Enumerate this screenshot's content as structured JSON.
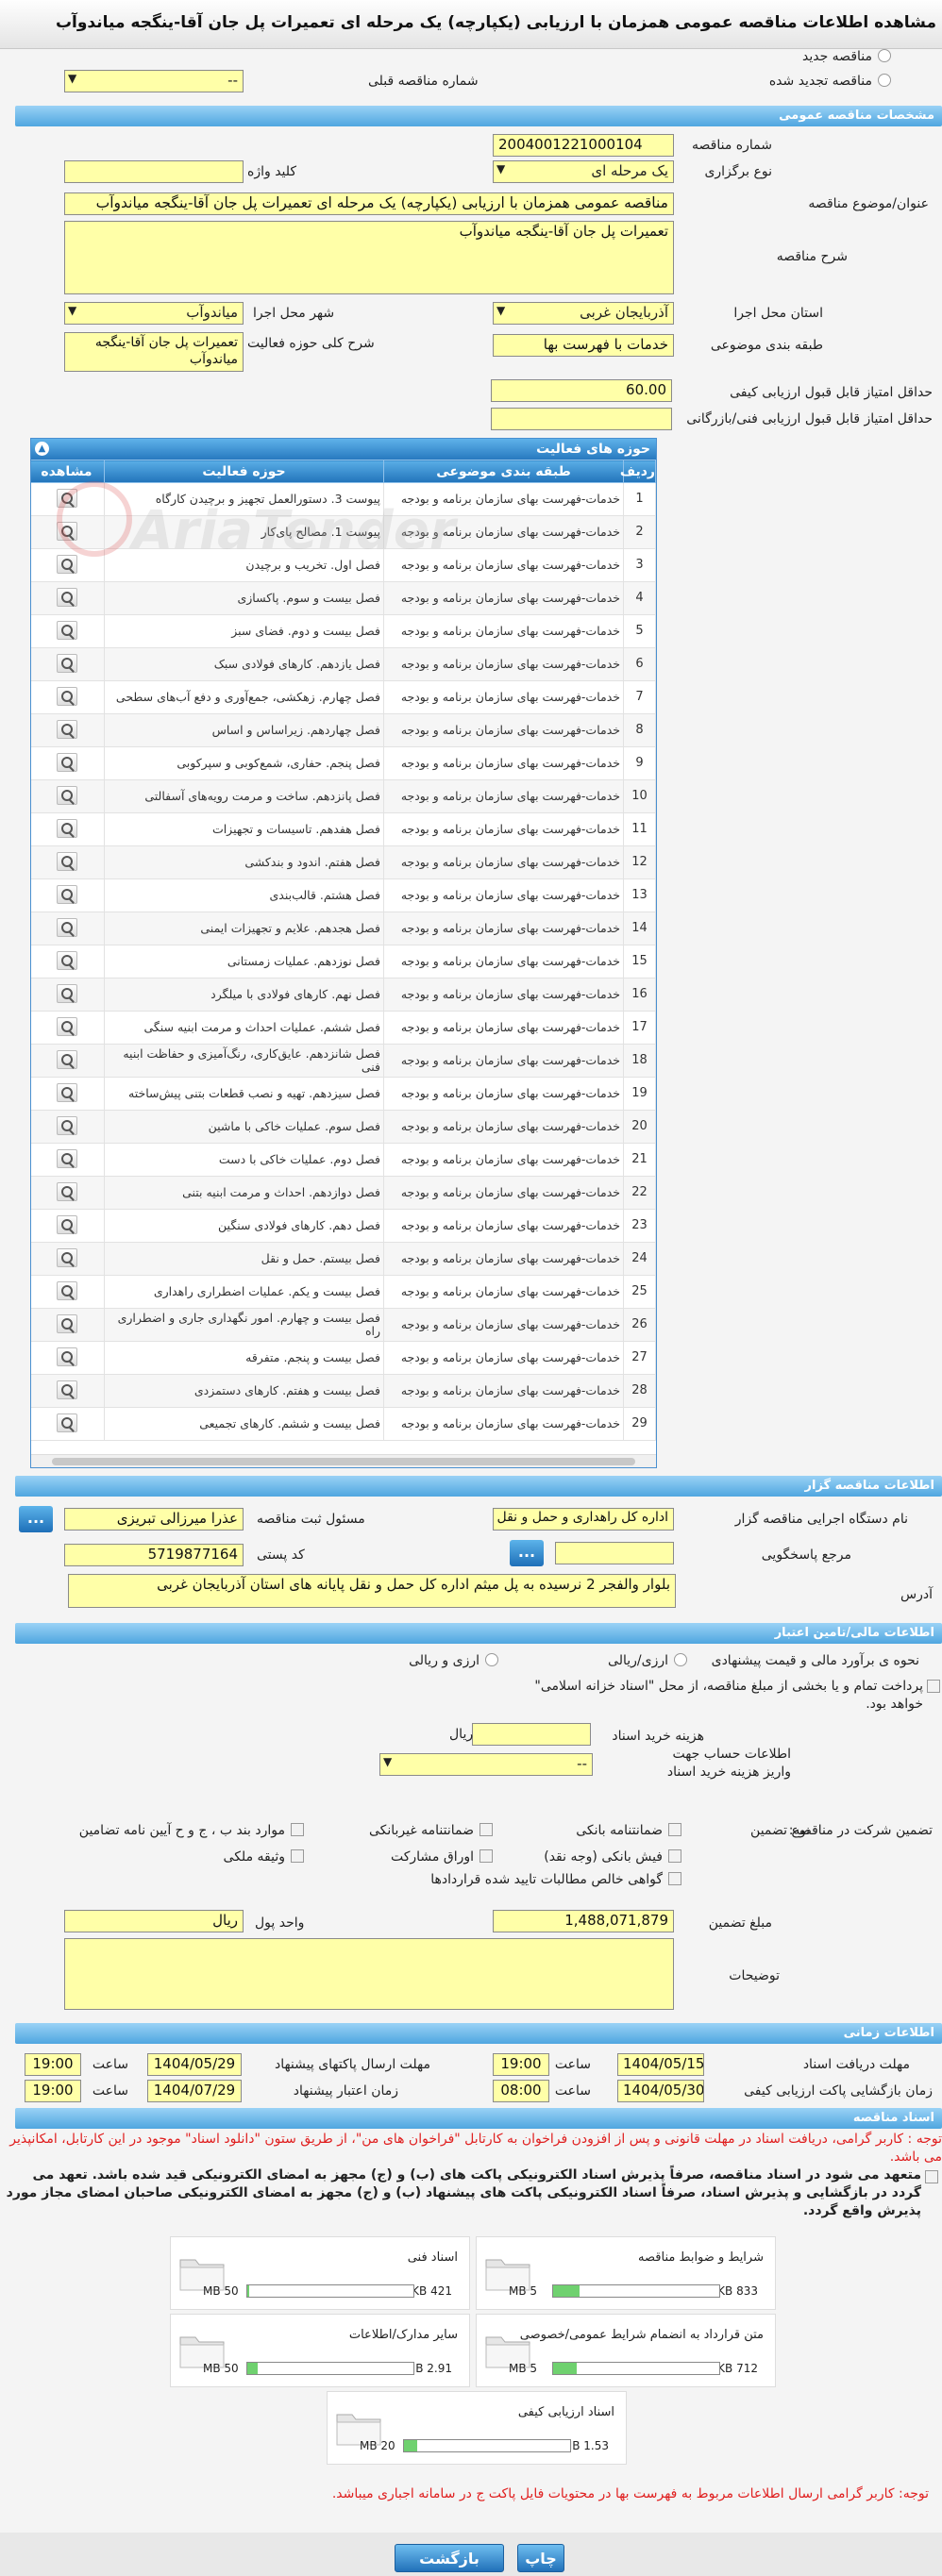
{
  "page": {
    "title": "مشاهده اطلاعات مناقصه عمومی همزمان با ارزیابی (یکپارچه) یک مرحله ای تعمیرات پل جان آقا-ینگجه میاندوآب"
  },
  "top": {
    "new_tender": "مناقصه جدید",
    "renewed_tender": "مناقصه تجدید شده",
    "prev_number_label": "شماره مناقصه قبلی",
    "prev_number_value": "--"
  },
  "general": {
    "bar": "مشخصات مناقصه عمومی",
    "number_label": "شماره مناقصه",
    "number_value": "2004001221000104",
    "type_label": "نوع برگزاری",
    "type_value": "یک مرحله ای",
    "keyword_label": "کلید واژه",
    "keyword_value": "",
    "title_label": "عنوان/موضوع مناقصه",
    "title_value": "مناقصه عمومی همزمان با ارزیابی (یکپارچه) یک مرحله ای تعمیرات پل جان آقا-ینگجه میاندوآب",
    "desc_label": "شرح مناقصه",
    "desc_value": "تعمیرات پل جان آقا-ینگجه میاندوآب",
    "province_label": "استان محل اجرا",
    "province_value": "آذربایجان غربی",
    "city_label": "شهر محل اجرا",
    "city_value": "میاندوآب",
    "category_label": "طبقه بندی موضوعی",
    "category_value": "خدمات با فهرست بها",
    "scope_label": "شرح کلی حوزه فعالیت",
    "scope_value": "تعمیرات پل جان آقا-ینگجه میاندوآب",
    "min_quality_label": "حداقل امتیاز قابل قبول ارزیابی کیفی",
    "min_quality_value": "60.00",
    "min_tech_label": "حداقل امتیاز قابل قبول ارزیابی فنی/بازرگانی",
    "min_tech_value": ""
  },
  "grid": {
    "title": "حوزه های فعالیت",
    "headers": [
      "ردیف",
      "طبقه بندی موضوعی",
      "حوزه فعالیت",
      "مشاهده"
    ],
    "rows": [
      [
        "1",
        "خدمات-فهرست بهای سازمان برنامه و بودجه",
        "پیوست 3. دستورالعمل تجهیز و برچیدن کارگاه"
      ],
      [
        "2",
        "خدمات-فهرست بهای سازمان برنامه و بودجه",
        "پیوست 1. مصالح پای‌کار"
      ],
      [
        "3",
        "خدمات-فهرست بهای سازمان برنامه و بودجه",
        "فصل اول. تخریب و برچیدن"
      ],
      [
        "4",
        "خدمات-فهرست بهای سازمان برنامه و بودجه",
        "فصل بیست و سوم. پاکسازی"
      ],
      [
        "5",
        "خدمات-فهرست بهای سازمان برنامه و بودجه",
        "فصل بیست و دوم. فضای سبز"
      ],
      [
        "6",
        "خدمات-فهرست بهای سازمان برنامه و بودجه",
        "فصل یازدهم. کارهای فولادی سبک"
      ],
      [
        "7",
        "خدمات-فهرست بهای سازمان برنامه و بودجه",
        "فصل چهارم. زهکشی، جمع‌آوری و دفع آب‌های سطحی"
      ],
      [
        "8",
        "خدمات-فهرست بهای سازمان برنامه و بودجه",
        "فصل چهاردهم. زیراساس و اساس"
      ],
      [
        "9",
        "خدمات-فهرست بهای سازمان برنامه و بودجه",
        "فصل پنجم. حفاری، شمع‌کوبی و سپرکوبی"
      ],
      [
        "10",
        "خدمات-فهرست بهای سازمان برنامه و بودجه",
        "فصل پانزدهم. ساخت و مرمت رویه‌های آسفالتی"
      ],
      [
        "11",
        "خدمات-فهرست بهای سازمان برنامه و بودجه",
        "فصل هفدهم. تاسیسات و تجهیزات"
      ],
      [
        "12",
        "خدمات-فهرست بهای سازمان برنامه و بودجه",
        "فصل هفتم. اندود و بندکشی"
      ],
      [
        "13",
        "خدمات-فهرست بهای سازمان برنامه و بودجه",
        "فصل هشتم. قالب‌بندی"
      ],
      [
        "14",
        "خدمات-فهرست بهای سازمان برنامه و بودجه",
        "فصل هجدهم. علایم و تجهیزات ایمنی"
      ],
      [
        "15",
        "خدمات-فهرست بهای سازمان برنامه و بودجه",
        "فصل نوزدهم. عملیات زمستانی"
      ],
      [
        "16",
        "خدمات-فهرست بهای سازمان برنامه و بودجه",
        "فصل نهم. کارهای فولادی با میلگرد"
      ],
      [
        "17",
        "خدمات-فهرست بهای سازمان برنامه و بودجه",
        "فصل ششم.  عملیات احداث و مرمت ابنیه سنگی"
      ],
      [
        "18",
        "خدمات-فهرست بهای سازمان برنامه و بودجه",
        "فصل شانزدهم. عایق‌کاری، رنگ‌آمیزی و حفاظت ابنیه فنی"
      ],
      [
        "19",
        "خدمات-فهرست بهای سازمان برنامه و بودجه",
        "فصل سیزدهم. تهیه و نصب قطعات بتنی پیش‌ساخته"
      ],
      [
        "20",
        "خدمات-فهرست بهای سازمان برنامه و بودجه",
        "فصل سوم. عملیات خاکی با ماشین"
      ],
      [
        "21",
        "خدمات-فهرست بهای سازمان برنامه و بودجه",
        "فصل دوم. عملیات خاکی با دست"
      ],
      [
        "22",
        "خدمات-فهرست بهای سازمان برنامه و بودجه",
        "فصل دوازدهم. احداث و مرمت ابنیه بتنی"
      ],
      [
        "23",
        "خدمات-فهرست بهای سازمان برنامه و بودجه",
        "فصل دهم. کارهای فولادی سنگین"
      ],
      [
        "24",
        "خدمات-فهرست بهای سازمان برنامه و بودجه",
        "فصل بیستم. حمل و نقل"
      ],
      [
        "25",
        "خدمات-فهرست بهای سازمان برنامه و بودجه",
        "فصل بیست و یکم. عملیات اضطراری راهداری"
      ],
      [
        "26",
        "خدمات-فهرست بهای سازمان برنامه و بودجه",
        "فصل بیست و چهارم. امور نگهداری جاری و اضطراری راه"
      ],
      [
        "27",
        "خدمات-فهرست بهای سازمان برنامه و بودجه",
        "فصل بیست و پنجم. متفرقه"
      ],
      [
        "28",
        "خدمات-فهرست بهای سازمان برنامه و بودجه",
        "فصل بیست و هفتم. کارهای دستمزدی"
      ],
      [
        "29",
        "خدمات-فهرست بهای سازمان برنامه و بودجه",
        "فصل بیست و ششم. کارهای تجمیعی"
      ]
    ]
  },
  "organizer": {
    "bar": "اطلاعات مناقصه گزار",
    "name_label": "نام دستگاه اجرایی مناقصه گزار",
    "name_value": "اداره کل راهداری و حمل و نقل",
    "owner_label": "مسئول ثبت مناقصه",
    "owner_value": "عذرا میرزالی تبریزی",
    "ref_label": "مرجع پاسخگویی",
    "ref_value": "",
    "postal_label": "کد پستی",
    "postal_value": "5719877164",
    "address_label": "آدرس",
    "address_value": "بلوار والفجر 2 نرسیده به پل میثم اداره کل حمل و نقل پایانه های استان آذربایجان غربی",
    "dots": "..."
  },
  "finance": {
    "bar": "اطلاعات مالی/تامین اعتبار",
    "estimate_label": "نحوه ی برآورد مالی و قیمت پیشنهادی",
    "opt1": "ارزی/ریالی",
    "opt2": "ارزی و ریالی",
    "treasury_text": "پرداخت تمام و یا بخشی از مبلغ مناقصه، از محل \"اسناد خزانه اسلامی\" خواهد بود.",
    "doc_fee_label": "هزینه خرید اسناد",
    "doc_fee_unit": "ریال",
    "account_label": "اطلاعات حساب جهت واریز هزینه خرید اسناد",
    "account_value": "--"
  },
  "guarantee": {
    "participation_label": "تضمین شرکت در مناقصه:",
    "type_label": "نوع تضمین",
    "items": [
      "ضمانتنامه بانکی",
      "ضمانتنامه غیربانکی",
      "موارد بند ب ، ج و ح آیین نامه تضامین",
      "فیش بانکی (وجه نقد)",
      "اوراق مشارکت",
      "وثیقه ملکی",
      "گواهی خالص مطالبات تایید شده قراردادها"
    ],
    "amount_label": "مبلغ تضمین",
    "amount_value": "1,488,071,879",
    "unit_label": "واحد پول",
    "unit_value": "ریال",
    "notes_label": "توضیحات",
    "notes_value": ""
  },
  "time": {
    "bar": "اطلاعات زمانی",
    "recv_label": "مهلت دریافت اسناد",
    "recv_date": "1404/05/15",
    "recv_time": "19:00",
    "send_label": "مهلت ارسال پاکتهای پیشنهاد",
    "send_date": "1404/05/29",
    "send_time": "19:00",
    "open_label": "زمان بازگشایی پاکت ارزیابی کیفی",
    "open_date": "1404/05/30",
    "open_time": "08:00",
    "valid_label": "زمان اعتبار پیشنهاد",
    "valid_date": "1404/07/29",
    "valid_time": "19:00",
    "time_word": "ساعت"
  },
  "docs": {
    "bar": "اسناد مناقصه",
    "notice1": "توجه : کاربر گرامی، دریافت اسناد در مهلت قانونی و پس از افزودن فراخوان به کارتابل \"فراخوان های من\"، از طریق ستون \"دانلود اسناد\" موجود در این کارتابل، امکانپذیر می باشد.",
    "notice2": "متعهد می شود در اسناد مناقصه، صرفاً پذیرش اسناد الکترونیکی پاکت های (ب) و (ج) مجهز به امضای الکترونیکی قید شده باشد. تعهد می گردد در بازگشایی و پذیرش اسناد، صرفاً اسناد الکترونیکی پاکت های پیشنهاد (ب) و (ج) مجهز به امضای الکترونیکی صاحبان امضای مجاز مورد پذیرش واقع گردد.",
    "files": [
      {
        "name": "شرایط و ضوابط مناقصه",
        "size": "833 KB",
        "max": "5 MB",
        "fill": 0.16
      },
      {
        "name": "اسناد فنی",
        "size": "421 KB",
        "max": "50 MB",
        "fill": 0.01
      },
      {
        "name": "متن قرارداد به انضمام شرایط عمومی/خصوصی",
        "size": "712 KB",
        "max": "5 MB",
        "fill": 0.14
      },
      {
        "name": "سایر مدارک/اطلاعات",
        "size": "2.91 MB",
        "max": "50 MB",
        "fill": 0.06
      },
      {
        "name": "اسناد ارزیابی کیفی",
        "size": "1.53 MB",
        "max": "20 MB",
        "fill": 0.08
      }
    ],
    "notice3": "توجه: کاربر گرامی ارسال اطلاعات مربوط به فهرست بها در محتویات فایل پاکت ج در سامانه اجباری میباشد."
  },
  "footer": {
    "print": "چاپ",
    "back": "بازگشت"
  },
  "colors": {
    "bar": "#4fa6e0",
    "field": "#ffffa8",
    "red": "#e02020"
  }
}
